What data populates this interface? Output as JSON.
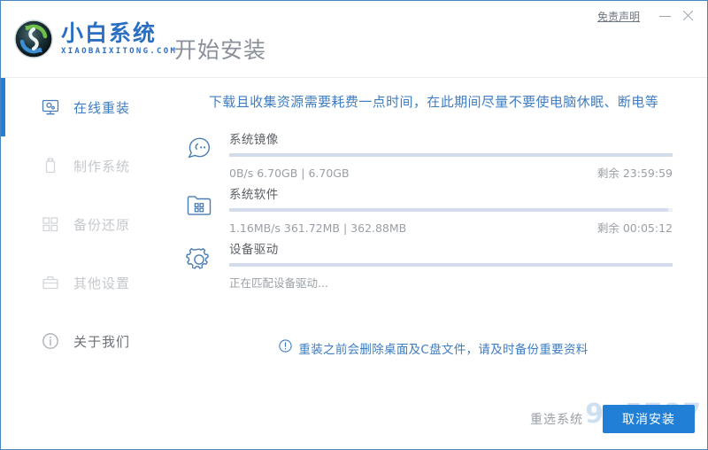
{
  "window": {
    "disclaimer_label": "免责声明",
    "minimize_label": "—",
    "close_label": "✕"
  },
  "brand": {
    "name_cn": "小白系统",
    "name_en": "XIAOBAIXITONG.COM",
    "logo_icon": "refresh-circle-logo-icon"
  },
  "header": {
    "page_title": "开始安装"
  },
  "sidebar": {
    "items": [
      {
        "label": "在线重装",
        "icon": "monitor-icon",
        "state": "active"
      },
      {
        "label": "制作系统",
        "icon": "usb-drive-icon",
        "state": "disabled"
      },
      {
        "label": "备份还原",
        "icon": "blocks-grid-icon",
        "state": "disabled"
      },
      {
        "label": "其他设置",
        "icon": "briefcase-icon",
        "state": "disabled"
      },
      {
        "label": "关于我们",
        "icon": "info-circle-icon",
        "state": "enabled"
      }
    ]
  },
  "main": {
    "notice": "下载且收集资源需要耗费一点时间，在此期间尽量不要使电脑休眠、断电等",
    "tasks": [
      {
        "name": "系统镜像",
        "icon": "ghost-face-icon",
        "progress_percent": 100,
        "status": "0B/s 6.70GB | 6.70GB",
        "remaining": "剩余 23:59:59"
      },
      {
        "name": "系统软件",
        "icon": "folder-apps-icon",
        "progress_percent": 99,
        "status": "1.16MB/s 361.72MB | 362.88MB",
        "remaining": "剩余 00:05:12"
      },
      {
        "name": "设备驱动",
        "icon": "gear-icon",
        "progress_percent": 100,
        "status": "正在匹配设备驱动...",
        "remaining": ""
      }
    ],
    "warning": {
      "icon": "exclamation-circle-icon",
      "text": "重装之前会删除桌面及C盘文件，请及时备份重要资料"
    }
  },
  "footer": {
    "reselect_label": "重选系统",
    "cancel_label": "取消安装"
  },
  "watermark": {
    "text": "9n5787"
  },
  "colors": {
    "accent": "#2180d6",
    "link_blue": "#3f7dc2",
    "muted": "#9aa0a6",
    "progress_track": "#eef1f4",
    "progress_fill": "#d3dceb"
  }
}
